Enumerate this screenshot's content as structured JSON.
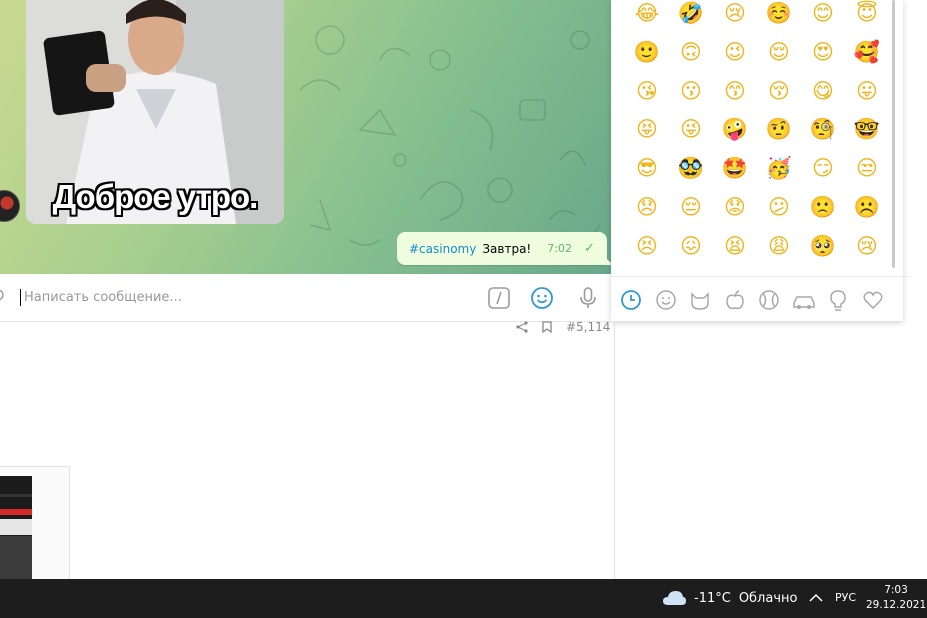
{
  "chat": {
    "gif_caption": "Доброе утро.",
    "message": {
      "hashtag": "#casinomy",
      "text": "Завтра!",
      "time": "7:02"
    }
  },
  "input": {
    "placeholder": "Написать сообщение..."
  },
  "emoji_panel": {
    "emojis": [
      "😂",
      "🤣",
      "😢",
      "☺️",
      "😊",
      "😇",
      "🙂",
      "🙃",
      "😉",
      "😌",
      "😍",
      "🥰",
      "😘",
      "😗",
      "😙",
      "😚",
      "😋",
      "😛",
      "😝",
      "😜",
      "🤪",
      "🤨",
      "🧐",
      "🤓",
      "😎",
      "🥸",
      "🤩",
      "🥳",
      "😏",
      "😒",
      "😞",
      "😔",
      "😟",
      "😕",
      "🙁",
      "☹️",
      "😣",
      "😖",
      "😫",
      "😩",
      "🥺",
      "😢"
    ],
    "categories": [
      "recent-icon",
      "smiley-icon",
      "cat-icon",
      "apple-icon",
      "ball-icon",
      "car-icon",
      "bulb-icon",
      "heart-icon"
    ]
  },
  "post": {
    "id": "#5,114"
  },
  "taskbar": {
    "temperature": "-11°C",
    "weather": "Облачно",
    "lang": "РУС",
    "time": "7:03",
    "date": "29.12.2021"
  },
  "colors": {
    "accent": "#2e9ad0",
    "bubble": "#effdde",
    "time_green": "#62b86b",
    "taskbar": "#1d1d1d"
  }
}
